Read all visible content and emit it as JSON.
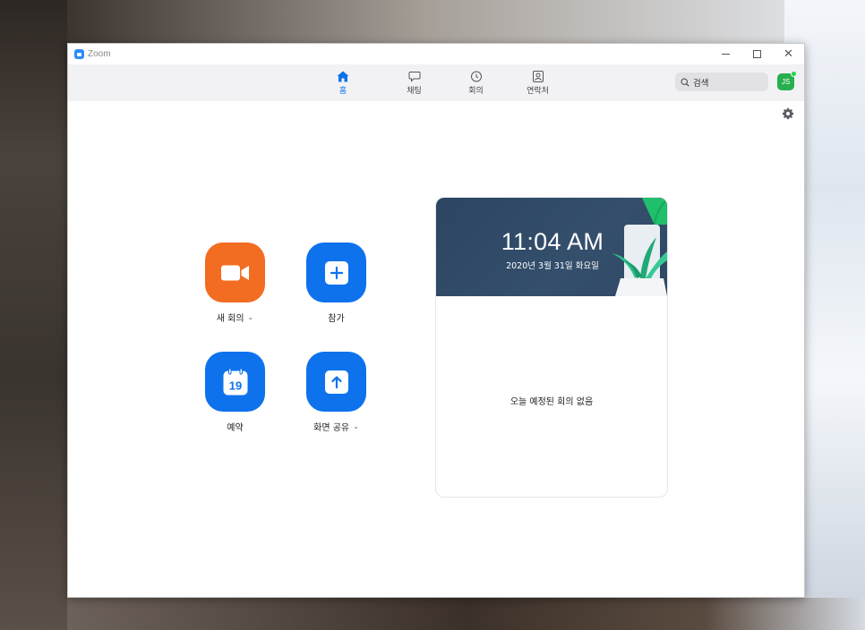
{
  "window": {
    "title": "Zoom",
    "controls": {
      "minimize": "minimize",
      "maximize": "maximize",
      "close": "✕"
    }
  },
  "nav": {
    "tabs": [
      {
        "label": "홈",
        "icon": "home-icon",
        "active": true
      },
      {
        "label": "채팅",
        "icon": "chat-icon",
        "active": false
      },
      {
        "label": "회의",
        "icon": "clock-icon",
        "active": false
      },
      {
        "label": "연락처",
        "icon": "contacts-icon",
        "active": false
      }
    ],
    "search": {
      "placeholder": "검색",
      "icon": "search-icon"
    },
    "avatar": {
      "initials": "JS",
      "status_color": "#27d34d"
    }
  },
  "actions": {
    "new_meeting": {
      "label": "새 회의",
      "icon": "video-camera-icon",
      "color": "#f26d21"
    },
    "join": {
      "label": "참가",
      "icon": "plus-icon",
      "color": "#0e72ed"
    },
    "schedule": {
      "label": "예약",
      "icon": "calendar-icon",
      "calendar_day": "19",
      "color": "#0e72ed"
    },
    "share_screen": {
      "label": "화면 공유",
      "icon": "upload-arrow-icon",
      "color": "#0e72ed"
    },
    "dropdown_glyph": "⌄"
  },
  "schedule_card": {
    "time": "11:04 AM",
    "date": "2020년 3월 31일 화요일",
    "empty_message": "오늘 예정된 회의 없음"
  },
  "colors": {
    "accent": "#0e71eb",
    "nav_bg": "#f2f2f5",
    "card_header": "#2f4a66"
  }
}
